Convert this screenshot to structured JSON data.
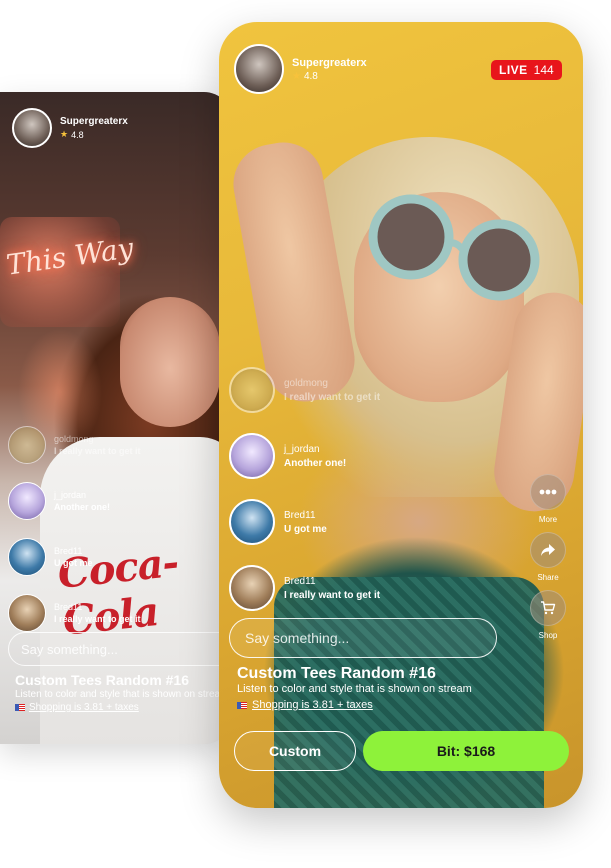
{
  "back_phone": {
    "host": {
      "name": "Supergreaterx",
      "rating": "4.8"
    },
    "comments": [
      {
        "user": "goldmong",
        "message": "I really want to get it",
        "faded": true
      },
      {
        "user": "j_jordan",
        "message": "Another one!",
        "faded": false
      },
      {
        "user": "Bred11",
        "message": "U got me",
        "faded": false
      },
      {
        "user": "Bred11",
        "message": "I really want to get it",
        "faded": false
      }
    ],
    "input_placeholder": "Say something...",
    "product_title": "Custom Tees Random #16",
    "product_desc": "Listen to color and style that is shown on stream",
    "shipping": "Shopping is 3.81 + taxes",
    "neon_text": "This Way"
  },
  "front_phone": {
    "host": {
      "name": "Supergreaterx",
      "rating": "4.8"
    },
    "live": {
      "label": "LIVE",
      "viewers": "144"
    },
    "comments": [
      {
        "user": "goldmong",
        "message": "I really want to get it",
        "faded": true
      },
      {
        "user": "j_jordan",
        "message": "Another one!",
        "faded": false
      },
      {
        "user": "Bred11",
        "message": "U got me",
        "faded": false
      },
      {
        "user": "Bred11",
        "message": "I really want to get it",
        "faded": false
      }
    ],
    "actions": [
      {
        "label": "More",
        "icon": "more-icon"
      },
      {
        "label": "Share",
        "icon": "share-icon"
      },
      {
        "label": "Shop",
        "icon": "cart-icon"
      }
    ],
    "input_placeholder": "Say something...",
    "product_title": "Custom Tees Random #16",
    "product_desc": "Listen to color and style that is shown on stream",
    "shipping": "Shopping is 3.81 + taxes",
    "custom_button": "Custom",
    "bid_button": "Bit: $168"
  },
  "colors": {
    "live_red": "#e8151b",
    "bid_green": "#8ef23a",
    "star": "#f7c23c"
  }
}
